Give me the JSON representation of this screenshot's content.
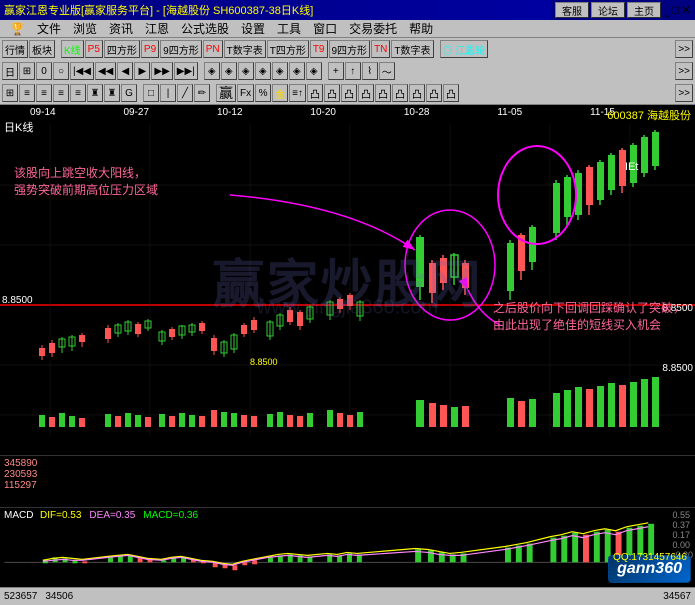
{
  "title": {
    "main": "赢家江恩专业版[赢家服务平台] - [海越股份 SH600387-38日K线]",
    "stock_code": "SH600387-38日K线",
    "stock_name": "海越股份",
    "code": "600387"
  },
  "service_buttons": {
    "customer": "客服",
    "forum": "论坛",
    "home": "主页"
  },
  "menu": {
    "items": [
      "文件",
      "浏览",
      "资讯",
      "江恩",
      "公式选股",
      "设置",
      "工具",
      "窗口",
      "交易委托",
      "帮助"
    ]
  },
  "toolbar": {
    "row1": [
      "行情",
      "板块",
      "K线",
      "P5",
      "四方形",
      "P9",
      "9四方形",
      "P9",
      "T数字表",
      "T四方形",
      "T9",
      "9四方形",
      "T9",
      "T数字表",
      "江恩轮"
    ],
    "row2": [
      "日",
      "冈",
      "0",
      "圆",
      "K",
      "K",
      "K",
      "K",
      "K",
      "K",
      "K",
      "K",
      "K",
      "K",
      "K",
      "K"
    ],
    "row3": [
      "Ħ",
      "Ħ",
      "Ħ",
      "Ħ",
      "Ħ",
      "罗",
      "罗",
      "G"
    ]
  },
  "chart": {
    "kline_label": "日K线",
    "dates": [
      "09-14",
      "09-27",
      "10-12",
      "10-20",
      "10-28",
      "11-05",
      "11-15"
    ],
    "stock_label": "600387 海越股份",
    "price_level": "8.8500",
    "price_level2": "8.8500",
    "annotation1": "该股向上跳空收大阳线，强势突破前期高位压力区域",
    "annotation2": "之后股价向下回调回踩确认了突破，\n由此出现了绝佳的短线买入机会",
    "volume_labels": [
      "345890",
      "230593",
      "115297"
    ],
    "watermark": "赢家炒股网",
    "watermark2": "www.yingjia360.com"
  },
  "macd": {
    "label": "MACD",
    "dif": "DIF=0.53",
    "dea": "DEA=0.35",
    "macd": "MACD=0.36",
    "levels": [
      "0.55",
      "0.37",
      "0.17",
      "0.00",
      "-0.20"
    ]
  },
  "status_bar": {
    "left": "",
    "numbers": [
      "523657",
      "34506"
    ]
  },
  "gann": {
    "logo": "gann360",
    "qq": "QQ:1731457646"
  }
}
